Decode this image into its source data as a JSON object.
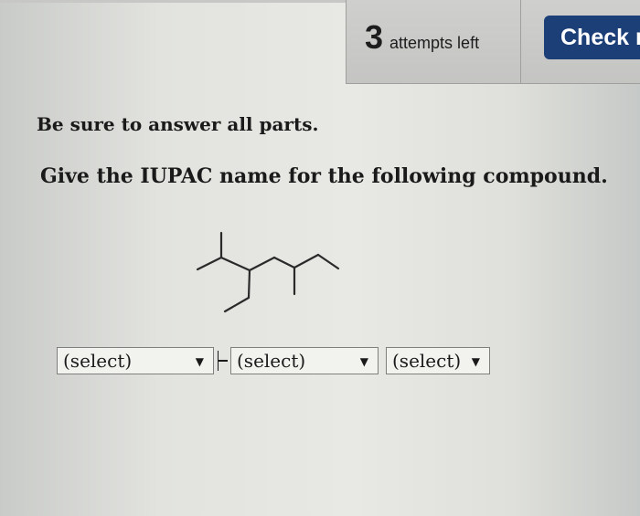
{
  "header": {
    "attempts_count": "3",
    "attempts_label": "attempts left",
    "check_label": "Check r"
  },
  "question": {
    "instruction": "Be sure to answer all parts.",
    "prompt": "Give the IUPAC name for the following compound."
  },
  "answer": {
    "selects": [
      {
        "value": "(select)"
      },
      {
        "value": "(select)"
      },
      {
        "value": "(select)"
      }
    ],
    "arrow_glyph": "▼"
  },
  "colors": {
    "check_button": "#1d3f78",
    "header_panel": "#c9cac7"
  },
  "icons": {
    "arrow": "chevron-down-icon"
  }
}
